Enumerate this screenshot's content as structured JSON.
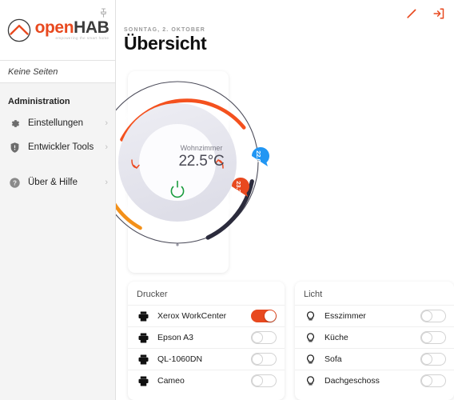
{
  "sidebar": {
    "pin_icon": "pin-icon",
    "logo": {
      "open": "open",
      "hab": "HAB",
      "tagline": "empowering the smart home"
    },
    "pages_empty_label": "Keine Seiten",
    "admin_section_label": "Administration",
    "items": [
      {
        "label": "Einstellungen",
        "icon": "gear-icon",
        "chevron": "›"
      },
      {
        "label": "Entwickler Tools",
        "icon": "shield-alert-icon",
        "chevron": "›"
      },
      {
        "label": "Über & Hilfe",
        "icon": "question-circle-icon",
        "chevron": "›"
      }
    ]
  },
  "header": {
    "date": "SONNTAG, 2. OKTOBER",
    "title": "Übersicht",
    "edit_icon": "pencil-icon",
    "login_icon": "login-icon"
  },
  "thermostat": {
    "room": "Wohnzimmer",
    "temperature": "22.5°C",
    "power_icon": "power-icon",
    "decrease_icon": "arrow-down-curved-icon",
    "increase_icon": "arrow-up-curved-icon",
    "badge_current": "22.6",
    "badge_target": "23.2",
    "badge_current_color": "#2196f3",
    "badge_target_color": "#e8491f",
    "arc_hot_color": "#f4511e",
    "arc_warm_color": "#f39019",
    "arc_track_color": "#2b2b3c"
  },
  "cards": [
    {
      "title": "Drucker",
      "icon": "printer-icon",
      "rows": [
        {
          "label": "Xerox WorkCenter",
          "state": "on"
        },
        {
          "label": "Epson A3",
          "state": "off"
        },
        {
          "label": "QL-1060DN",
          "state": "off"
        },
        {
          "label": "Cameo",
          "state": "off"
        }
      ]
    },
    {
      "title": "Licht",
      "icon": "bulb-icon",
      "rows": [
        {
          "label": "Esszimmer",
          "state": "off"
        },
        {
          "label": "Küche",
          "state": "off"
        },
        {
          "label": "Sofa",
          "state": "off"
        },
        {
          "label": "Dachgeschoss",
          "state": "off"
        }
      ]
    }
  ],
  "colors": {
    "accent": "#e8491f",
    "sidebar_bg": "#f4f4f4",
    "power_green": "#1a9c3e"
  }
}
